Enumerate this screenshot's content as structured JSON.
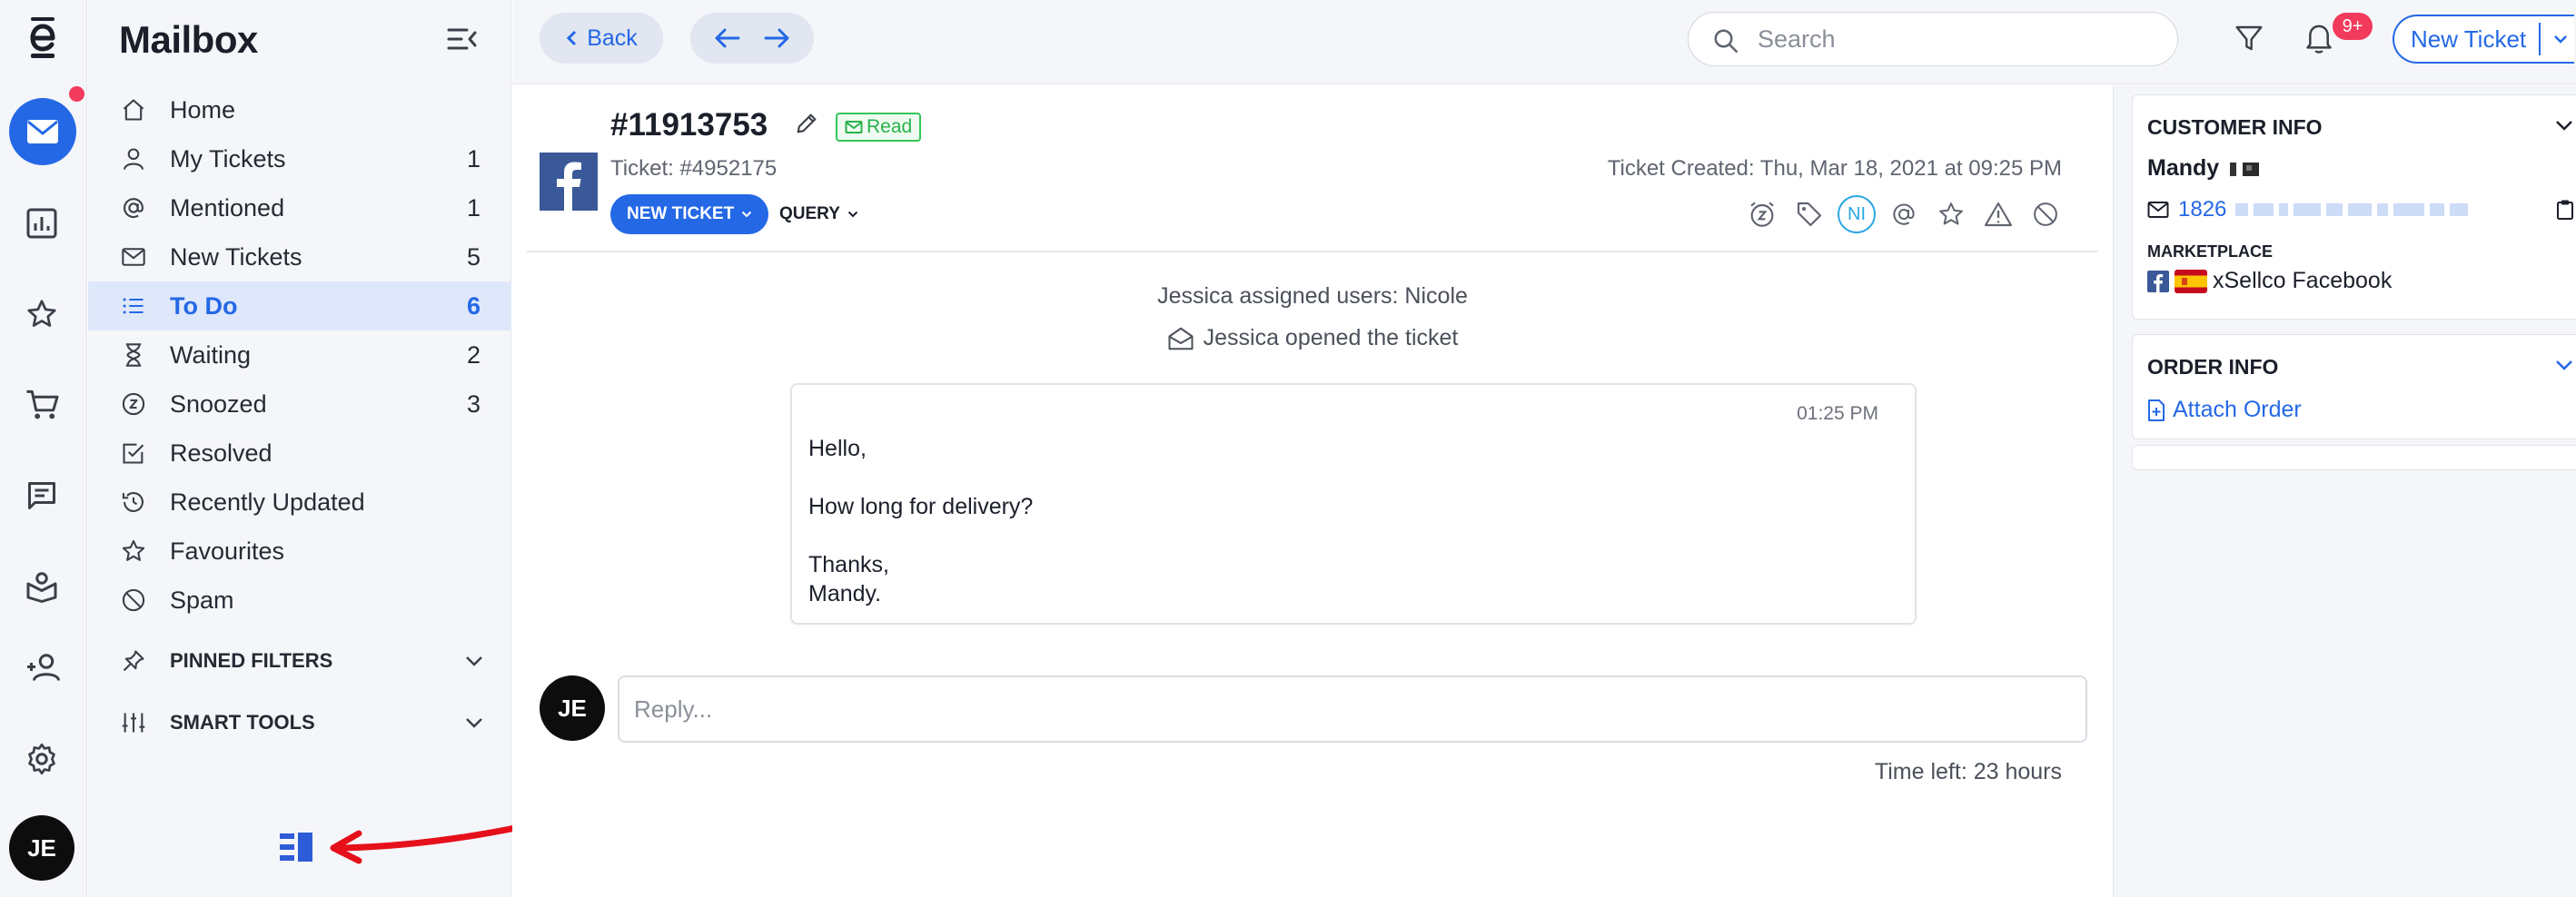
{
  "rail": {
    "avatar_initials": "JE",
    "icons": [
      "logo-e-icon",
      "mail-icon",
      "reports-icon",
      "star-icon",
      "cart-icon",
      "chat-icon",
      "knowledge-icon",
      "add-user-icon",
      "settings-icon"
    ]
  },
  "sidebar": {
    "title": "Mailbox",
    "items": [
      {
        "label": "Home",
        "count": "",
        "icon": "home-icon"
      },
      {
        "label": "My Tickets",
        "count": "1",
        "icon": "user-icon"
      },
      {
        "label": "Mentioned",
        "count": "1",
        "icon": "at-icon"
      },
      {
        "label": "New Tickets",
        "count": "5",
        "icon": "mail-icon"
      },
      {
        "label": "To Do",
        "count": "6",
        "icon": "list-icon",
        "active": true
      },
      {
        "label": "Waiting",
        "count": "2",
        "icon": "hourglass-icon"
      },
      {
        "label": "Snoozed",
        "count": "3",
        "icon": "snooze-icon"
      },
      {
        "label": "Resolved",
        "count": "",
        "icon": "checkbox-icon"
      },
      {
        "label": "Recently Updated",
        "count": "",
        "icon": "history-icon"
      },
      {
        "label": "Favourites",
        "count": "",
        "icon": "star-icon"
      },
      {
        "label": "Spam",
        "count": "",
        "icon": "block-icon"
      }
    ],
    "sections": [
      {
        "label": "PINNED FILTERS",
        "icon": "pin-icon"
      },
      {
        "label": "SMART TOOLS",
        "icon": "sliders-icon"
      }
    ]
  },
  "topbar": {
    "back_label": "Back",
    "search_placeholder": "Search",
    "notification_badge": "9+",
    "new_ticket_label": "New Ticket"
  },
  "ticket": {
    "number": "#11913753",
    "status_label": "Read",
    "sub_number": "Ticket: #4952175",
    "created": "Ticket Created: Thu, Mar 18, 2021 at 09:25 PM",
    "new_ticket_btn": "NEW TICKET",
    "query_btn": "QUERY",
    "assignee_badge": "NI",
    "events": {
      "assigned": "Jessica assigned users: Nicole",
      "opened": "Jessica opened the ticket"
    },
    "message": {
      "time": "01:25 PM",
      "lines": [
        "Hello,",
        "How long for delivery?",
        "Thanks,",
        "Mandy."
      ]
    },
    "reply": {
      "avatar_initials": "JE",
      "placeholder": "Reply..."
    },
    "time_left": "Time left: 23 hours"
  },
  "customer_info": {
    "title": "CUSTOMER INFO",
    "name": "Mandy",
    "phone_prefix": "1826",
    "marketplace_label": "MARKETPLACE",
    "marketplace_value": "xSellco Facebook"
  },
  "order_info": {
    "title": "ORDER INFO",
    "attach_label": "Attach Order"
  },
  "colors": {
    "accent": "#2468e6",
    "badge_red": "#f23a5c",
    "read_green": "#34c759",
    "facebook": "#3b5998"
  }
}
